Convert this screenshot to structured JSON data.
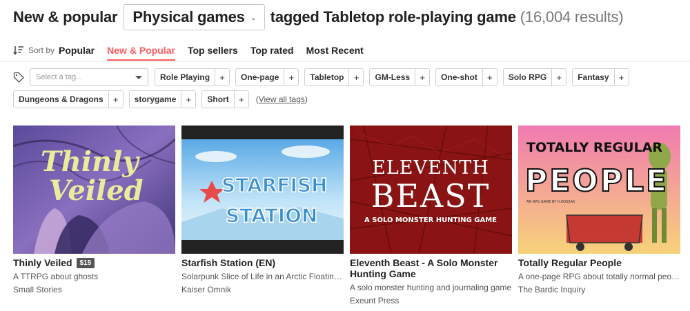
{
  "header": {
    "title": "New & popular",
    "category": "Physical games",
    "tagged_text": "tagged Tabletop role-playing game",
    "results": "(16,004 results)"
  },
  "sort": {
    "label": "Sort by",
    "selected": "Popular",
    "tabs": [
      {
        "label": "New & Popular",
        "active": true
      },
      {
        "label": "Top sellers",
        "active": false
      },
      {
        "label": "Top rated",
        "active": false
      },
      {
        "label": "Most Recent",
        "active": false
      }
    ]
  },
  "tag_filter": {
    "placeholder": "Select a tag...",
    "tags_row1": [
      "Role Playing",
      "One-page",
      "Tabletop",
      "GM-Less",
      "One-shot",
      "Solo RPG",
      "Fantasy"
    ],
    "tags_row2": [
      "Dungeons & Dragons",
      "storygame",
      "Short"
    ],
    "view_all": "View all tags",
    "plus": "+"
  },
  "games": [
    {
      "title": "Thinly Veiled",
      "price": "$15",
      "description": "A TTRPG about ghosts",
      "author": "Small Stories",
      "cover_text": [
        "Thinly",
        "Veiled"
      ]
    },
    {
      "title": "Starfish Station (EN)",
      "price": "",
      "description": "Solarpunk Slice of Life in an Arctic Floating Station",
      "author": "Kaiser Omnik",
      "cover_text": [
        "STARFISH",
        "STATION"
      ]
    },
    {
      "title": "Eleventh Beast - A Solo Monster Hunting Game",
      "price": "",
      "description": "A solo monster hunting and journaling game",
      "author": "Exeunt Press",
      "cover_text": [
        "ELEVENTH",
        "BEAST",
        "A SOLO MONSTER HUNTING GAME"
      ]
    },
    {
      "title": "Totally Regular People",
      "price": "",
      "description": "A one-page RPG about totally normal people doing normal things",
      "author": "The Bardic Inquiry",
      "cover_text": [
        "TOTALLY REGULAR",
        "PEOPLE",
        "AN RPG GAME BY H.KOSSAK"
      ]
    }
  ],
  "colors": {
    "accent": "#fa5c5c",
    "text": "#222222",
    "muted": "#555555"
  }
}
